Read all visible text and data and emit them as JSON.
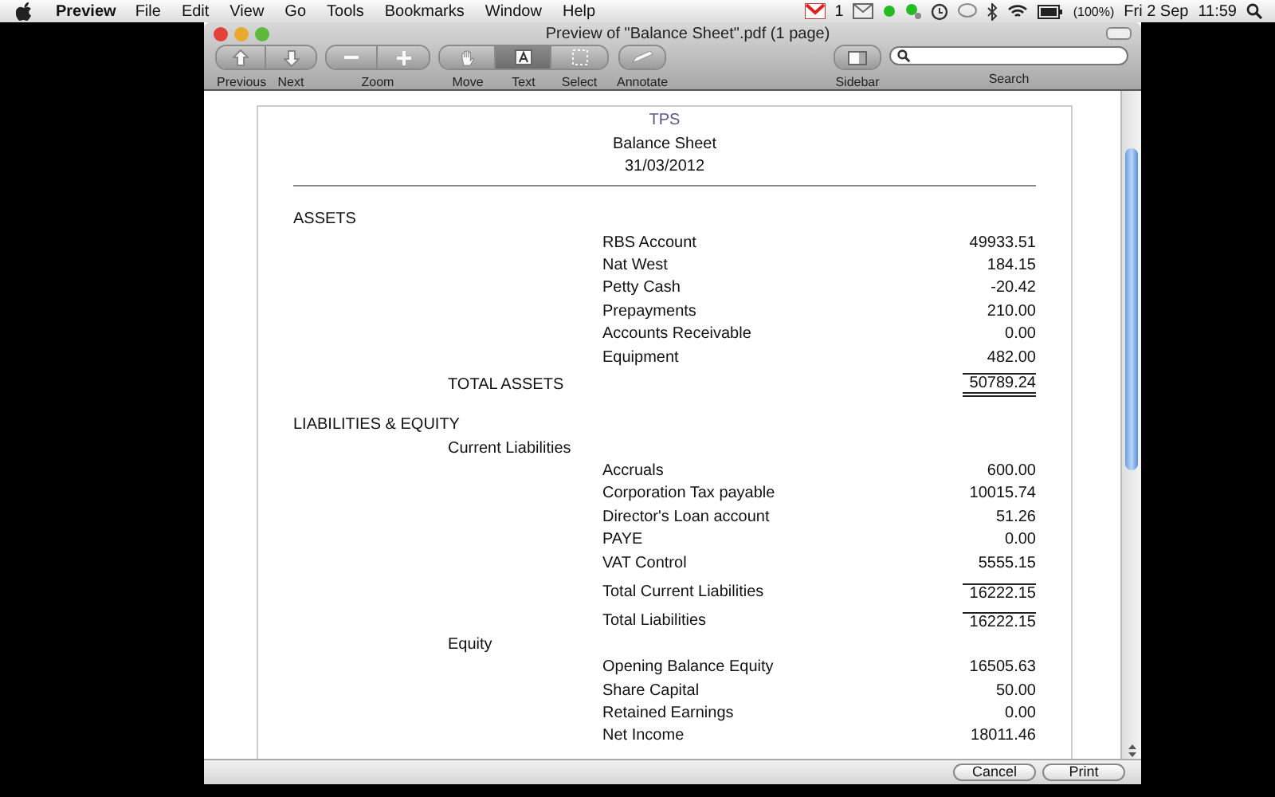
{
  "menu_bar": {
    "app": "Preview",
    "items": [
      "File",
      "Edit",
      "View",
      "Go",
      "Tools",
      "Bookmarks",
      "Window",
      "Help"
    ],
    "mail_count": "1",
    "battery": "(100%)",
    "date": "Fri 2 Sep",
    "time": "11:59"
  },
  "window": {
    "title": "Preview of \"Balance Sheet\".pdf (1 page)"
  },
  "toolbar": {
    "nav": [
      {
        "label": "Previous"
      },
      {
        "label": "Next"
      }
    ],
    "zoom_label": "Zoom",
    "tools": [
      {
        "label": "Move",
        "selected": false
      },
      {
        "label": "Text",
        "selected": true
      },
      {
        "label": "Select",
        "selected": false
      }
    ],
    "annotate": "Annotate",
    "sidebar": "Sidebar",
    "search_label": "Search"
  },
  "document": {
    "company": "TPS",
    "title": "Balance Sheet",
    "date": "31/03/2012",
    "rows": [
      {
        "kind": "section",
        "label": "ASSETS"
      },
      {
        "kind": "item",
        "label": "RBS Account",
        "amount": "49933.51"
      },
      {
        "kind": "item",
        "label": "Nat West",
        "amount": "184.15"
      },
      {
        "kind": "item",
        "label": "Petty Cash",
        "amount": "-20.42"
      },
      {
        "kind": "item",
        "label": "Prepayments",
        "amount": "210.00"
      },
      {
        "kind": "item",
        "label": "Accounts Receivable",
        "amount": "0.00"
      },
      {
        "kind": "item",
        "label": "Equipment",
        "amount": "482.00"
      },
      {
        "kind": "grand_total",
        "label": "TOTAL ASSETS",
        "amount": "50789.24"
      },
      {
        "kind": "section",
        "label": "LIABILITIES & EQUITY"
      },
      {
        "kind": "group",
        "label": "Current Liabilities"
      },
      {
        "kind": "item",
        "label": "Accruals",
        "amount": "600.00"
      },
      {
        "kind": "item",
        "label": "Corporation Tax payable",
        "amount": "10015.74"
      },
      {
        "kind": "item",
        "label": "Director's Loan account",
        "amount": "51.26"
      },
      {
        "kind": "item",
        "label": "PAYE",
        "amount": "0.00"
      },
      {
        "kind": "item",
        "label": "VAT Control",
        "amount": "5555.15"
      },
      {
        "kind": "subtotal",
        "label": "Total Current Liabilities",
        "amount": "16222.15"
      },
      {
        "kind": "subtotal",
        "label": "Total Liabilities",
        "amount": "16222.15"
      },
      {
        "kind": "group",
        "label": "Equity"
      },
      {
        "kind": "item",
        "label": "Opening Balance Equity",
        "amount": "16505.63"
      },
      {
        "kind": "item",
        "label": "Share Capital",
        "amount": "50.00"
      },
      {
        "kind": "item",
        "label": "Retained Earnings",
        "amount": "0.00"
      },
      {
        "kind": "item",
        "label": "Net Income",
        "amount": "18011.46"
      }
    ]
  },
  "buttons": [
    "Cancel",
    "Print"
  ]
}
